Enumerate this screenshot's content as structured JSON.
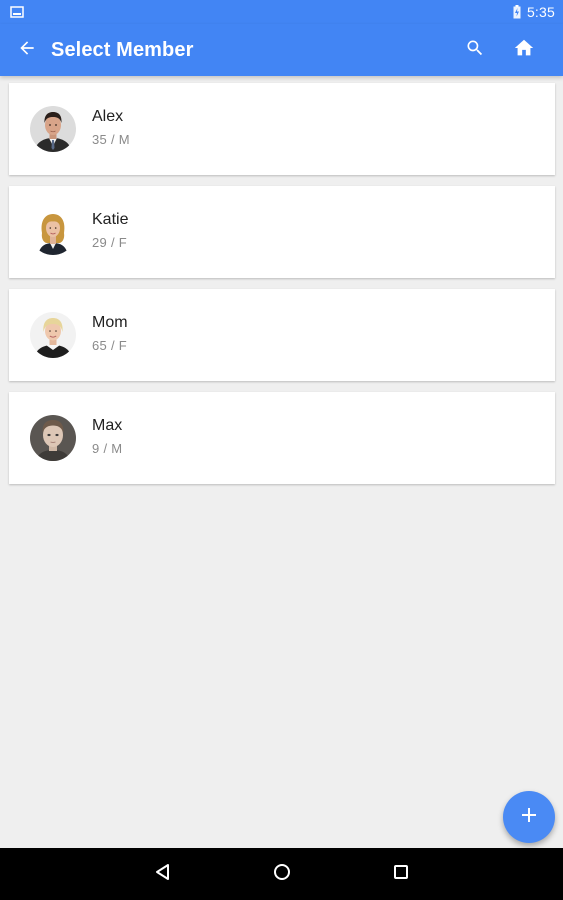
{
  "status_bar": {
    "time": "5:35",
    "left_icon": "screenshot-icon",
    "battery_icon": "battery-charging-icon"
  },
  "app_bar": {
    "title": "Select Member",
    "back_icon": "arrow-back-icon",
    "search_icon": "search-icon",
    "home_icon": "home-icon",
    "background": "#4285f4"
  },
  "members": [
    {
      "name": "Alex",
      "meta": "35 / M"
    },
    {
      "name": "Katie",
      "meta": "29 / F"
    },
    {
      "name": "Mom",
      "meta": "65 / F"
    },
    {
      "name": "Max",
      "meta": "9 / M"
    }
  ],
  "fab": {
    "icon": "plus-icon",
    "color": "#4a8af4"
  },
  "nav_bar": {
    "back_icon": "nav-back-triangle-icon",
    "home_icon": "nav-home-circle-icon",
    "recents_icon": "nav-recents-square-icon"
  }
}
